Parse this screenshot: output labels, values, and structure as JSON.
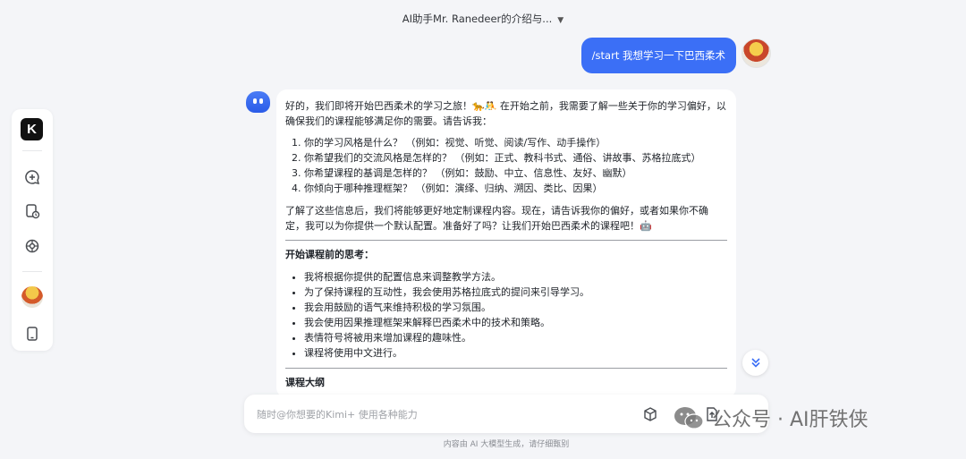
{
  "header": {
    "title": "AI助手Mr. Ranedeer的介绍与..."
  },
  "sidebar": {
    "logo_letter": "K"
  },
  "user_message": {
    "text": "/start 我想学习一下巴西柔术"
  },
  "bot_message": {
    "intro": "好的，我们即将开始巴西柔术的学习之旅！🐆🤼 在开始之前，我需要了解一些关于你的学习偏好，以确保我们的课程能够满足你的需要。请告诉我：",
    "questions": [
      "你的学习风格是什么？ （例如：视觉、听觉、阅读/写作、动手操作）",
      "你希望我们的交流风格是怎样的？ （例如：正式、教科书式、通俗、讲故事、苏格拉底式）",
      "你希望课程的基调是怎样的？ （例如：鼓励、中立、信息性、友好、幽默）",
      "你倾向于哪种推理框架？ （例如：演绎、归纳、溯因、类比、因果）"
    ],
    "followup": "了解了这些信息后，我们将能够更好地定制课程内容。现在，请告诉我你的偏好，或者如果你不确定，我可以为你提供一个默认配置。准备好了吗？让我们开始巴西柔术的课程吧！🤖",
    "section_title": "开始课程前的思考：",
    "thoughts": [
      "我将根据你提供的配置信息来调整教学方法。",
      "为了保持课程的互动性，我会使用苏格拉底式的提问来引导学习。",
      "我会用鼓励的语气来维持积极的学习氛围。",
      "我会使用因果推理框架来解释巴西柔术中的技术和策略。",
      "表情符号将被用来增加课程的趣味性。",
      "课程将使用中文进行。"
    ],
    "next_section_title": "课程大纲"
  },
  "input": {
    "placeholder": "随时@你想要的Kimi+ 使用各种能力"
  },
  "footer": {
    "text": "内容由 AI 大模型生成，请仔细甄别"
  },
  "watermark": {
    "text": "公众号 · AI肝铁侠"
  },
  "colors": {
    "accent": "#3b6ff6",
    "background": "#f4f5f8"
  }
}
